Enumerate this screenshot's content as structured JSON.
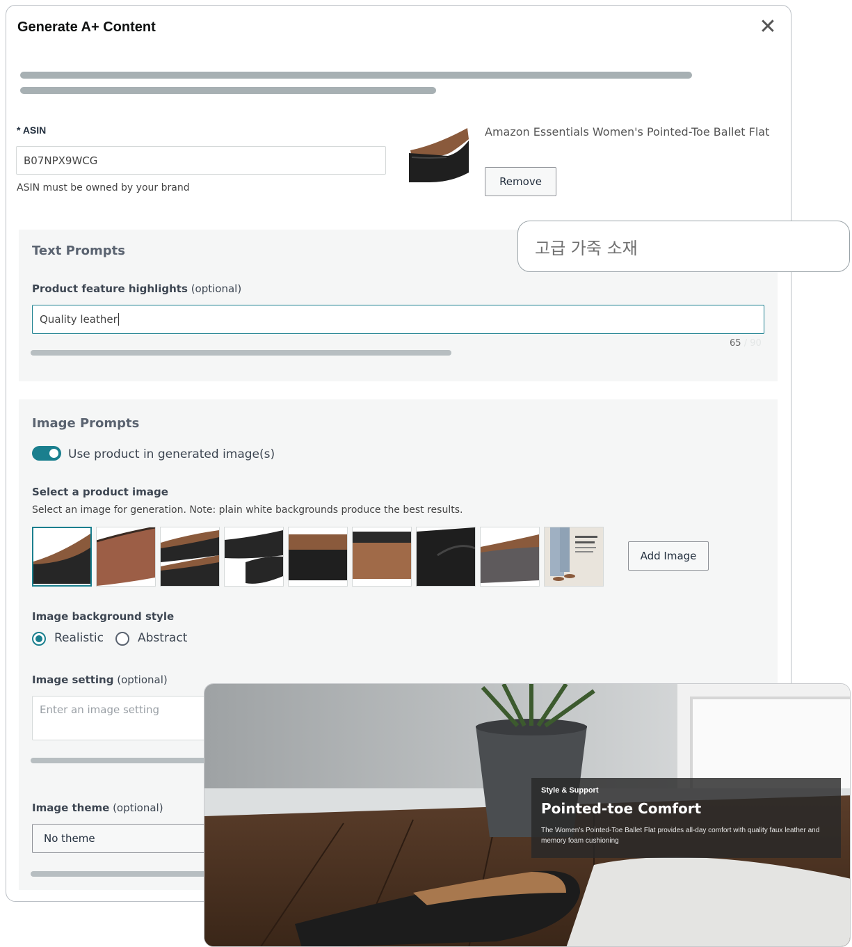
{
  "modal": {
    "title": "Generate A+ Content",
    "close_icon": "close-icon"
  },
  "asin": {
    "label": "* ASIN",
    "value": "B07NPX9WCG",
    "helper": "ASIN must be owned by your brand"
  },
  "product": {
    "name": "Amazon Essentials Women's Pointed-Toe Ballet Flat",
    "remove_label": "Remove"
  },
  "text_prompts": {
    "title": "Text Prompts",
    "highlights_label": "Product feature highlights",
    "optional_suffix": "(optional)",
    "highlights_value": "Quality leather",
    "char_count": "65",
    "char_count_max": "/ 90"
  },
  "image_prompts": {
    "title": "Image Prompts",
    "toggle_label": "Use product in generated image(s)",
    "select_label": "Select a product image",
    "select_help": "Select an image for generation. Note: plain white backgrounds produce the best results.",
    "add_image_label": "Add Image",
    "bg_style_label": "Image background style",
    "bg_options": [
      "Realistic",
      "Abstract"
    ],
    "setting_label": "Image setting",
    "setting_placeholder": "Enter an image setting",
    "theme_label": "Image theme",
    "theme_value": "No theme",
    "optional_suffix": "(optional)"
  },
  "translation_bubble": {
    "text": "고급 가죽 소재"
  },
  "preview": {
    "kicker": "Style & Support",
    "title": "Pointed-toe Comfort",
    "description": "The Women's Pointed-Toe Ballet Flat provides all-day comfort with quality faux leather and memory foam cushioning"
  },
  "colors": {
    "accent": "#1a7f8e",
    "panel_bg": "#f5f6f6",
    "skeleton": "#a7b0b3"
  }
}
